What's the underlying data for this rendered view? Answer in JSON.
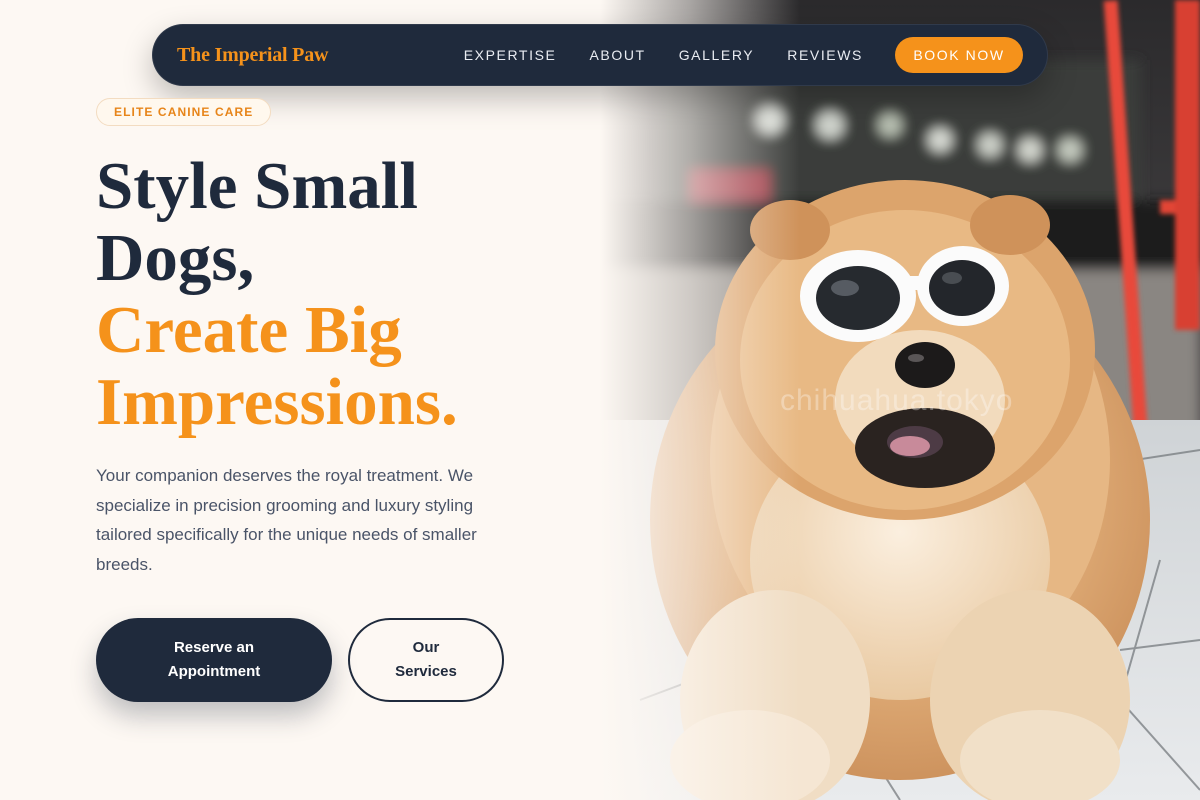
{
  "nav": {
    "brand": "The Imperial Paw",
    "links": [
      "EXPERTISE",
      "ABOUT",
      "GALLERY",
      "REVIEWS"
    ],
    "cta": "BOOK NOW"
  },
  "hero": {
    "badge": "ELITE CANINE CARE",
    "headline_dark_1": "Style Small",
    "headline_dark_2": "Dogs,",
    "headline_accent_1": "Create Big",
    "headline_accent_2": "Impressions.",
    "description": "Your companion deserves the royal treatment. We specialize in precision grooming and luxury styling tailored specifically for the unique needs of smaller breeds.",
    "primary_button": "Reserve an Appointment",
    "secondary_button": "Our Services",
    "watermark": "chihuahua.tokyo"
  },
  "colors": {
    "accent": "#f5921b",
    "navy": "#1f2a3c",
    "background": "#fdf8f3"
  }
}
